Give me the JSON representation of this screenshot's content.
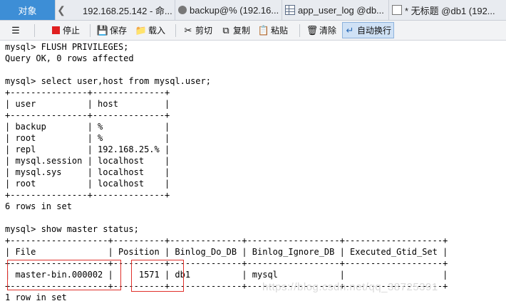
{
  "tabs": [
    {
      "label": "对象",
      "icon": "none",
      "active": true
    },
    {
      "label": "192.168.25.142 - 命...",
      "icon": "terminal-icon"
    },
    {
      "label": "backup@% (192.16...",
      "icon": "user-icon"
    },
    {
      "label": "app_user_log @db...",
      "icon": "table-icon"
    },
    {
      "label": "* 无标题 @db1 (192...",
      "icon": "query-icon"
    }
  ],
  "toolbar": {
    "menu_icon": "hamburger-icon",
    "stop": "停止",
    "save": "保存",
    "load": "载入",
    "cut": "剪切",
    "copy": "复制",
    "paste": "粘贴",
    "clear": "清除",
    "word_wrap": "自动换行"
  },
  "console": {
    "lines": [
      "mysql> FLUSH PRIVILEGES;",
      "Query OK, 0 rows affected",
      "",
      "mysql> select user,host from mysql.user;",
      "+---------------+--------------+",
      "| user          | host         |",
      "+---------------+--------------+",
      "| backup        | %            |",
      "| root          | %            |",
      "| repl          | 192.168.25.% |",
      "| mysql.session | localhost    |",
      "| mysql.sys     | localhost    |",
      "| root          | localhost    |",
      "+---------------+--------------+",
      "6 rows in set",
      "",
      "mysql> show master status;",
      "+-------------------+----------+--------------+------------------+-------------------+",
      "| File              | Position | Binlog_Do_DB | Binlog_Ignore_DB | Executed_Gtid_Set |",
      "+-------------------+----------+--------------+------------------+-------------------+",
      "| master-bin.000002 |     1571 | db1          | mysql            |                   |",
      "+-------------------+----------+--------------+------------------+-------------------+",
      "1 row in set"
    ]
  },
  "watermark": "https://blog.csdn.net/qq_38725391",
  "colors": {
    "active_tab": "#3d8ed6",
    "highlight_box": "#e0302a",
    "stop_icon": "#e02020"
  }
}
